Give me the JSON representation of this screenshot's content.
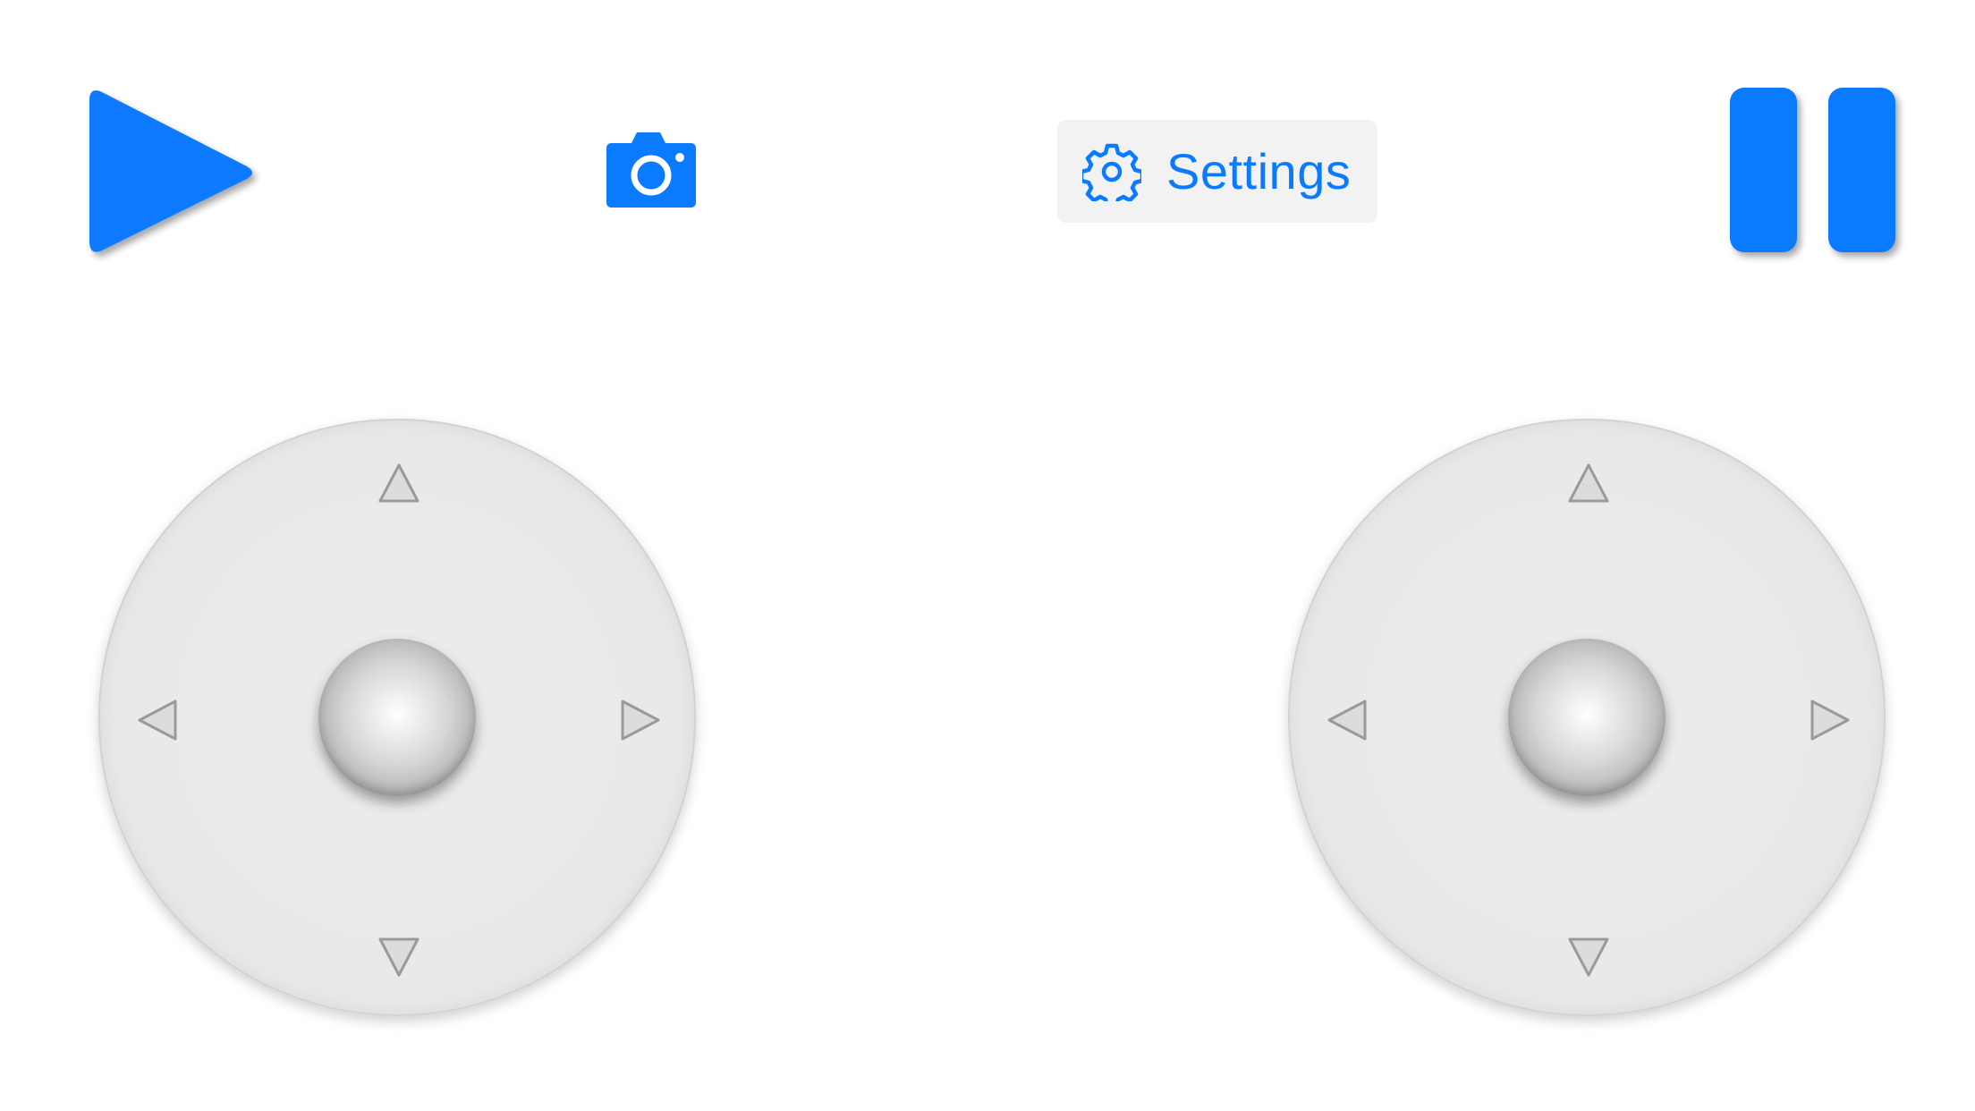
{
  "colors": {
    "accent": "#0a7aff",
    "settings_bg": "#f2f2f3",
    "joystick_base": "#e9e9e9",
    "arrow": "#9a9a9a"
  },
  "toolbar": {
    "play_icon": "play-icon",
    "camera_icon": "camera-icon",
    "settings_icon": "gear-icon",
    "settings_label": "Settings",
    "pause_icon": "pause-icon"
  },
  "joysticks": [
    {
      "id": "left",
      "arrows": [
        "up",
        "down",
        "left",
        "right"
      ]
    },
    {
      "id": "right",
      "arrows": [
        "up",
        "down",
        "left",
        "right"
      ]
    }
  ]
}
